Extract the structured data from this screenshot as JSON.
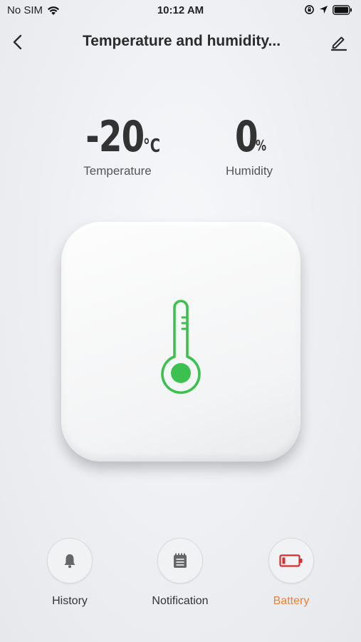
{
  "status_bar": {
    "carrier": "No SIM",
    "time": "10:12 AM"
  },
  "header": {
    "title": "Temperature and humidity..."
  },
  "readings": {
    "temperature": {
      "value": "-20",
      "unit": "°C",
      "label": "Temperature"
    },
    "humidity": {
      "value": "0",
      "unit": "%",
      "label": "Humidity"
    }
  },
  "device": {
    "icon": "thermometer-icon",
    "accent_color": "#3cc14f"
  },
  "actions": [
    {
      "label": "History",
      "icon": "bell-icon"
    },
    {
      "label": "Notification",
      "icon": "notepad-icon"
    },
    {
      "label": "Battery",
      "icon": "battery-low-icon",
      "color": "#ee8035"
    }
  ]
}
